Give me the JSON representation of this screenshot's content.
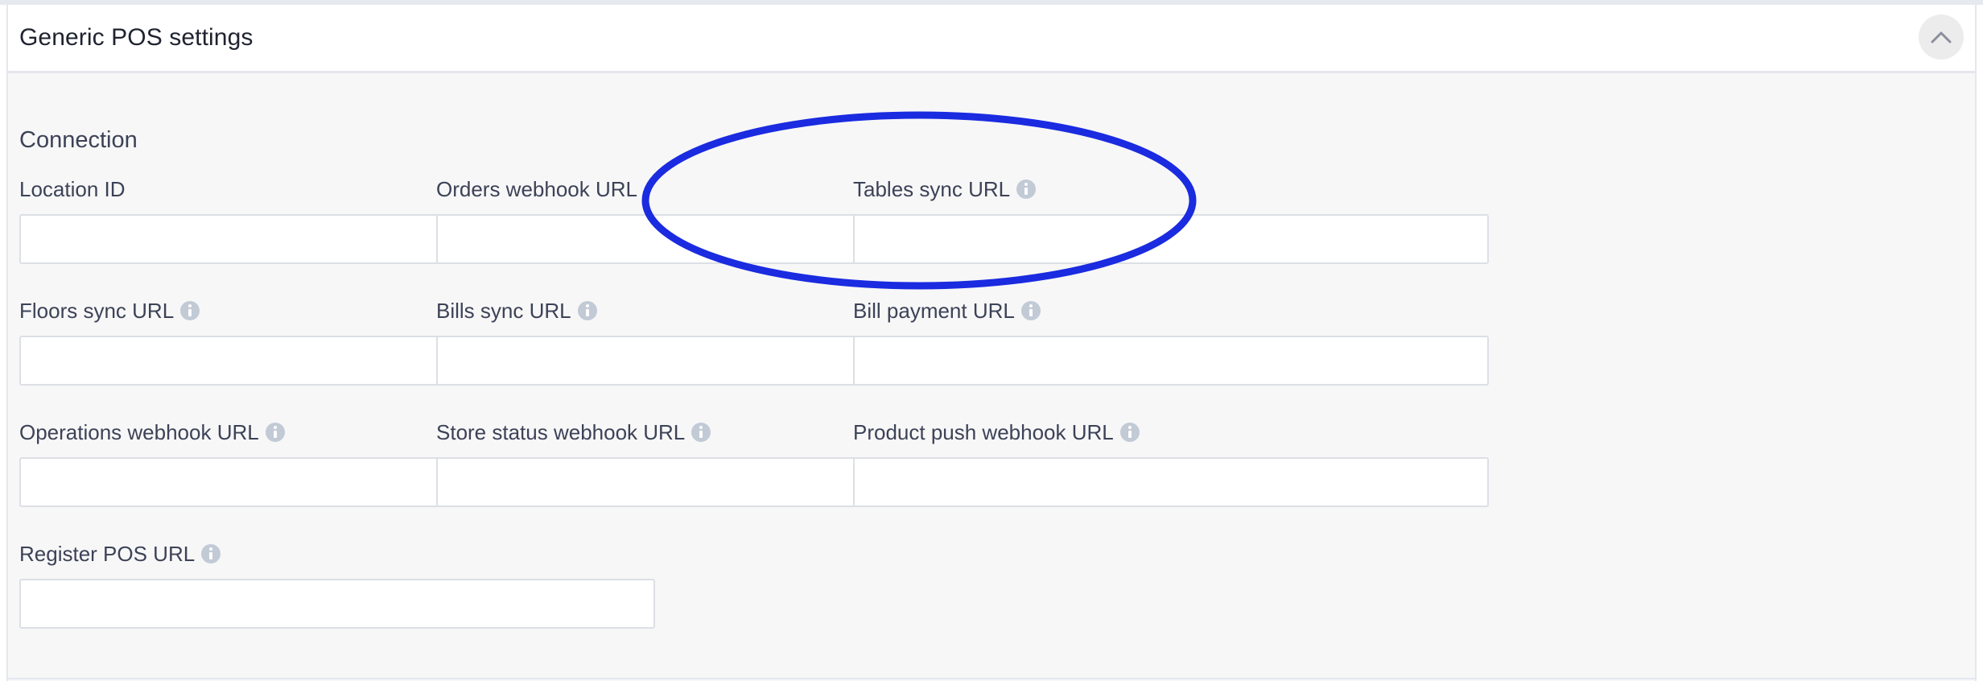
{
  "panel": {
    "title": "Generic POS settings",
    "collapse_icon": "chevron-up-icon"
  },
  "connection": {
    "section_title": "Connection",
    "fields": {
      "location_id": {
        "label": "Location ID",
        "value": "",
        "has_info": false
      },
      "orders_webhook_url": {
        "label": "Orders webhook URL",
        "value": "",
        "has_info": false
      },
      "tables_sync_url": {
        "label": "Tables sync URL",
        "value": "",
        "has_info": true
      },
      "floors_sync_url": {
        "label": "Floors sync URL",
        "value": "",
        "has_info": true
      },
      "bills_sync_url": {
        "label": "Bills sync URL",
        "value": "",
        "has_info": true
      },
      "bill_payment_url": {
        "label": "Bill payment URL",
        "value": "",
        "has_info": true
      },
      "operations_webhook_url": {
        "label": "Operations webhook URL",
        "value": "",
        "has_info": true
      },
      "store_status_webhook_url": {
        "label": "Store status webhook URL",
        "value": "",
        "has_info": true
      },
      "product_push_webhook_url": {
        "label": "Product push webhook URL",
        "value": "",
        "has_info": true
      },
      "register_pos_url": {
        "label": "Register POS URL",
        "value": "",
        "has_info": true
      }
    }
  },
  "annotation": {
    "shape": "ellipse",
    "color": "#1a2be0",
    "target": "Orders webhook URL"
  },
  "colors": {
    "panel_bg": "#f7f7f7",
    "input_border": "#dcdfe4",
    "info_icon": "#c2cad6",
    "text": "#3c4257"
  }
}
